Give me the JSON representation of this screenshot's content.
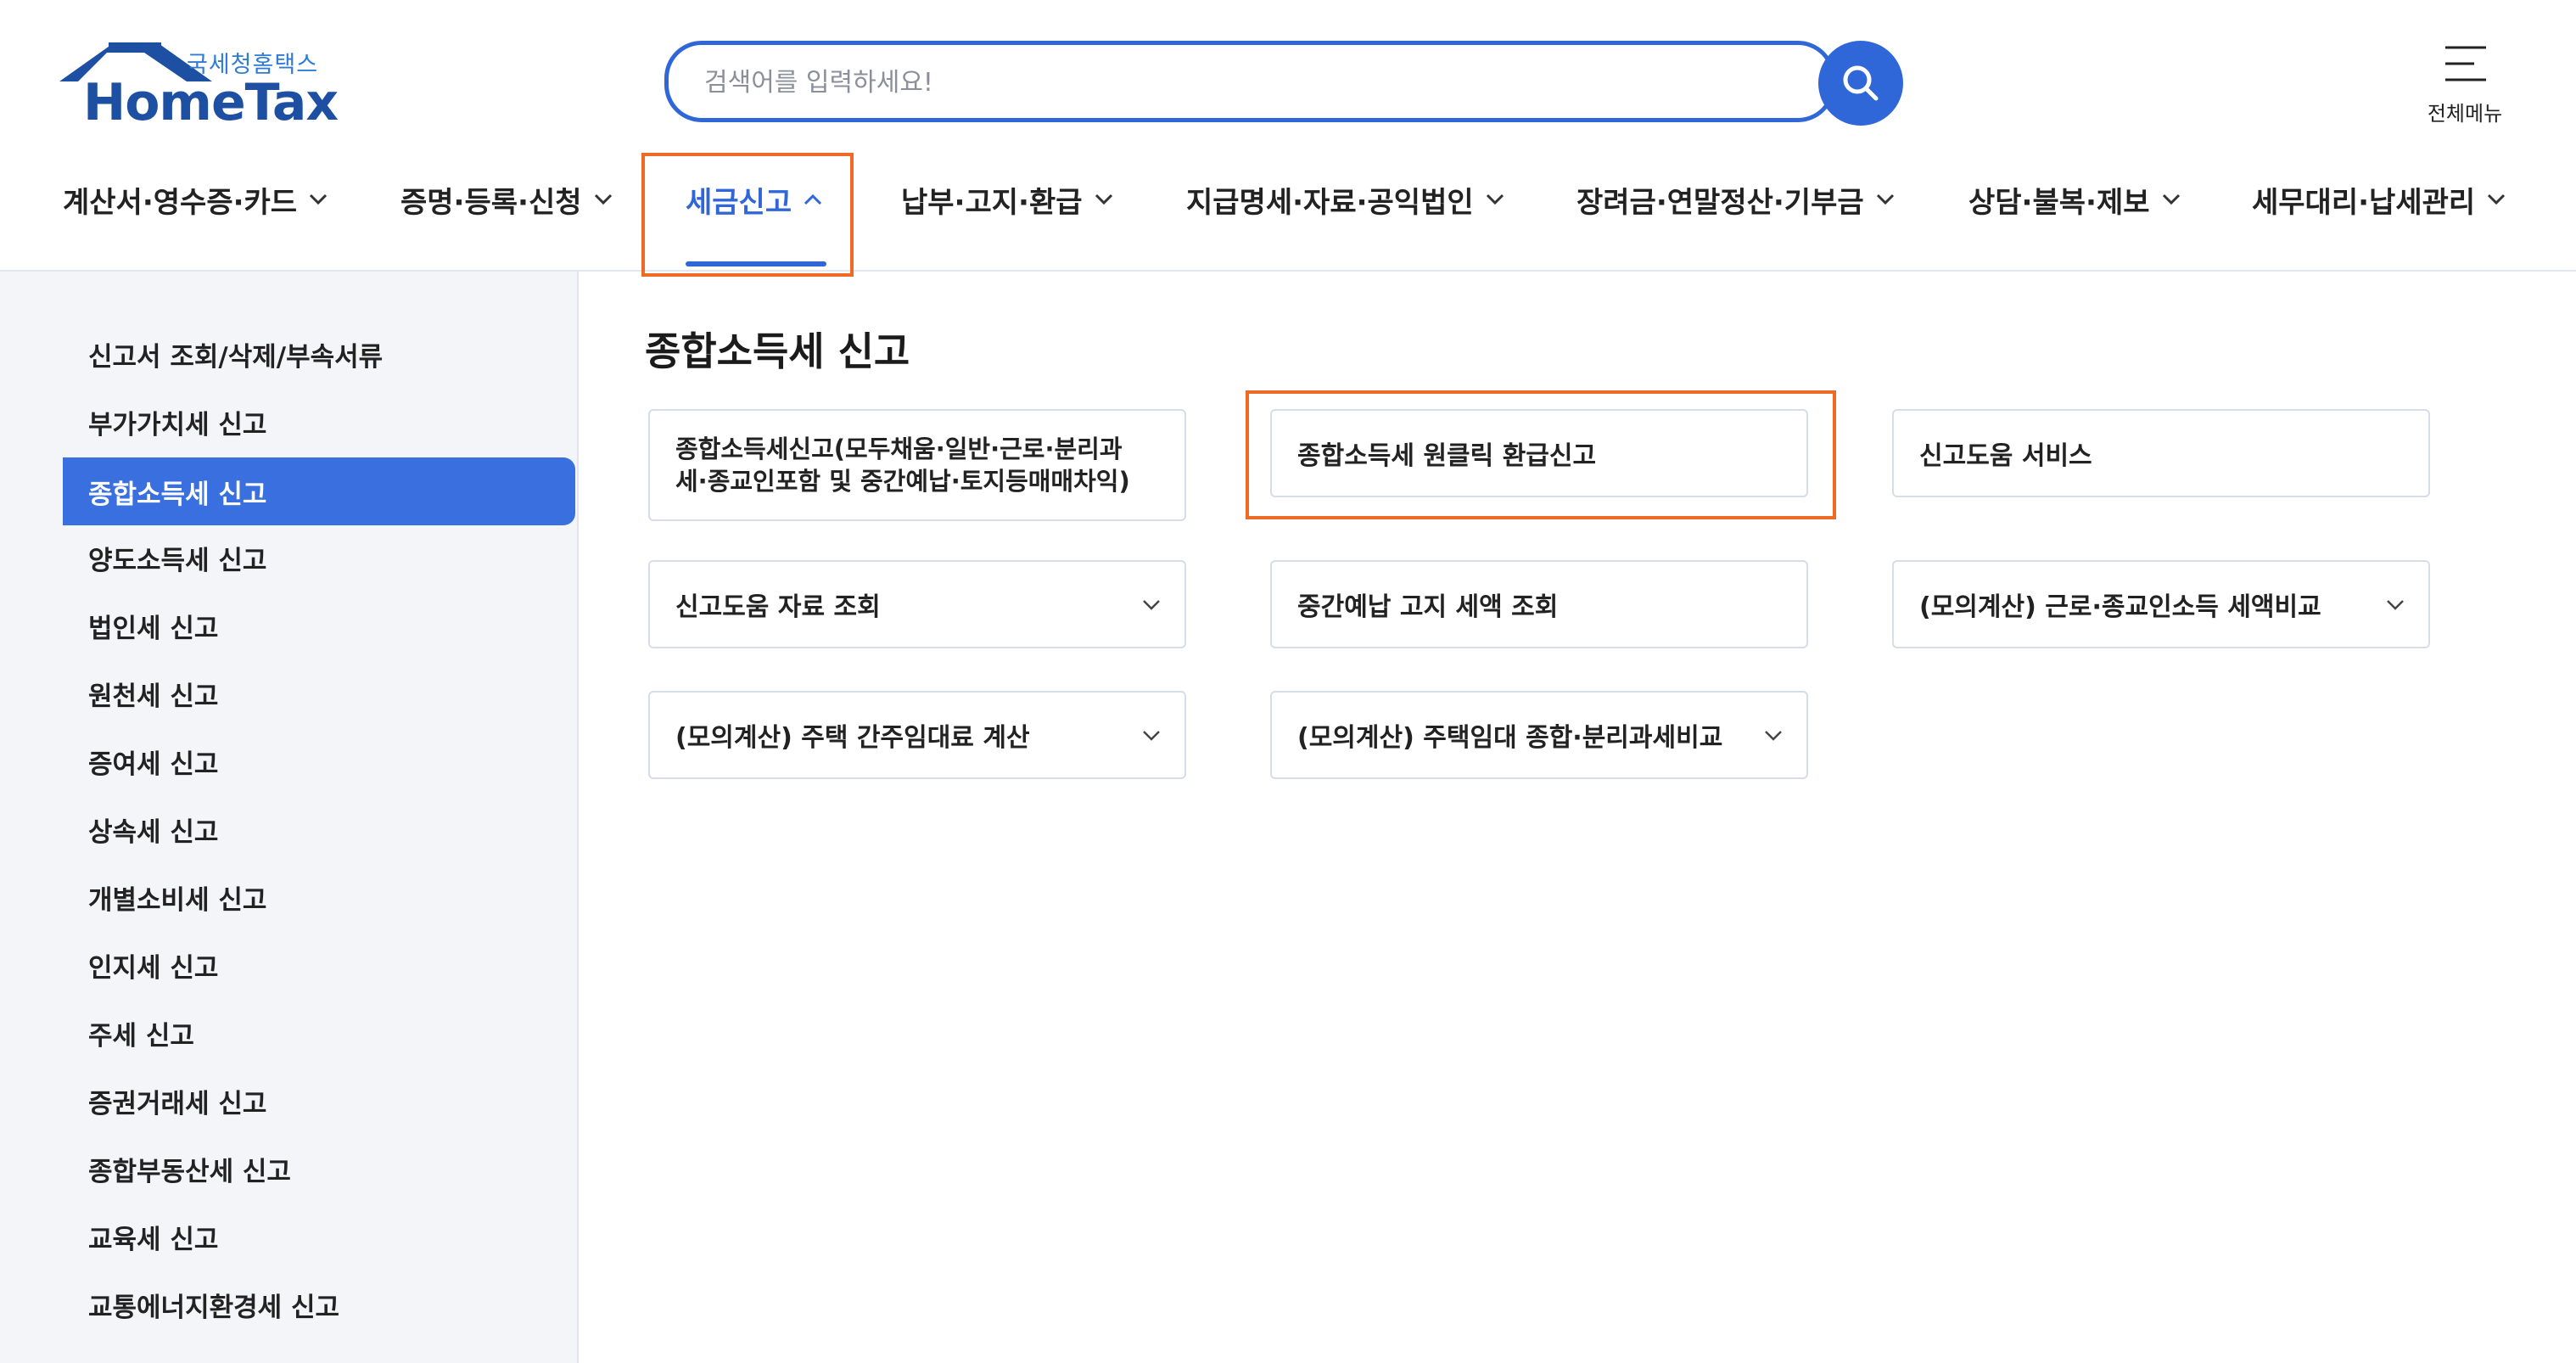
{
  "logo": {
    "korean": "국세청홈택스",
    "english": "HomeTax"
  },
  "search": {
    "placeholder": "검색어를 입력하세요!"
  },
  "header": {
    "all_menu_label": "전체메뉴"
  },
  "gnb": [
    {
      "label": "계산서·영수증·카드",
      "active": false
    },
    {
      "label": "증명·등록·신청",
      "active": false
    },
    {
      "label": "세금신고",
      "active": true
    },
    {
      "label": "납부·고지·환급",
      "active": false
    },
    {
      "label": "지급명세·자료·공익법인",
      "active": false
    },
    {
      "label": "장려금·연말정산·기부금",
      "active": false
    },
    {
      "label": "상담·불복·제보",
      "active": false
    },
    {
      "label": "세무대리·납세관리",
      "active": false
    }
  ],
  "sidebar": {
    "items": [
      {
        "label": "신고서 조회/삭제/부속서류"
      },
      {
        "label": "부가가치세 신고"
      },
      {
        "label": "종합소득세 신고",
        "active": true
      },
      {
        "label": "양도소득세 신고"
      },
      {
        "label": "법인세 신고"
      },
      {
        "label": "원천세 신고"
      },
      {
        "label": "증여세 신고"
      },
      {
        "label": "상속세 신고"
      },
      {
        "label": "개별소비세 신고"
      },
      {
        "label": "인지세 신고"
      },
      {
        "label": "주세 신고"
      },
      {
        "label": "증권거래세 신고"
      },
      {
        "label": "종합부동산세 신고"
      },
      {
        "label": "교육세 신고"
      },
      {
        "label": "교통에너지환경세 신고"
      }
    ]
  },
  "main": {
    "title": "종합소득세 신고",
    "cards": [
      {
        "label": "종합소득세신고(모두채움·일반·근로·분리과세·종교인포함 및 중간예납·토지등매매차익)",
        "has_dropdown": false
      },
      {
        "label": "종합소득세 원클릭 환급신고",
        "has_dropdown": false,
        "highlighted": true
      },
      {
        "label": "신고도움 서비스",
        "has_dropdown": false
      },
      {
        "label": "신고도움 자료 조회",
        "has_dropdown": true
      },
      {
        "label": "중간예납 고지 세액 조회",
        "has_dropdown": false
      },
      {
        "label": "(모의계산) 근로·종교인소득 세액비교",
        "has_dropdown": true
      },
      {
        "label": "(모의계산) 주택 간주임대료 계산",
        "has_dropdown": true
      },
      {
        "label": "(모의계산) 주택임대 종합·분리과세비교",
        "has_dropdown": true
      }
    ]
  },
  "colors": {
    "primary": "#2f66d8",
    "highlight": "#ef6b25",
    "sidebar_bg": "#f4f5f8",
    "logo_blue": "#1d4fa3"
  },
  "icons": {
    "search": "search-icon",
    "menu": "hamburger-icon",
    "chevron_down": "chevron-down-icon",
    "chevron_up": "chevron-up-icon"
  }
}
